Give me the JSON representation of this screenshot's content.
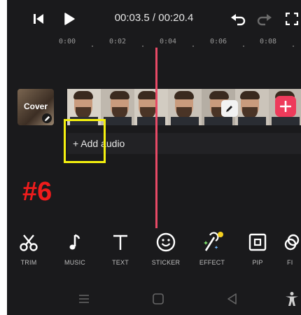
{
  "player": {
    "current_time": "00:03.5",
    "total_time": "00:20.4",
    "separator": " / "
  },
  "ruler": {
    "ticks": [
      "0:00",
      "0:02",
      "0:04",
      "0:06",
      "0:08"
    ]
  },
  "track": {
    "cover_label": "Cover",
    "add_audio_label": "+ Add audio"
  },
  "annotation": {
    "step_label": "#6",
    "highlight_color": "#f5f10f",
    "step_color": "#ee1c1c"
  },
  "toolbar": {
    "items": [
      {
        "label": "TRIM",
        "icon": "scissors-icon"
      },
      {
        "label": "MUSIC",
        "icon": "music-note-icon"
      },
      {
        "label": "TEXT",
        "icon": "text-icon"
      },
      {
        "label": "STICKER",
        "icon": "smiley-icon"
      },
      {
        "label": "EFFECT",
        "icon": "magic-wand-icon"
      },
      {
        "label": "PIP",
        "icon": "pip-icon"
      },
      {
        "label": "FI",
        "icon": "filter-icon"
      }
    ]
  },
  "colors": {
    "accent": "#ee3b5b",
    "playhead": "#e84a66",
    "background": "#1a1a1c"
  }
}
